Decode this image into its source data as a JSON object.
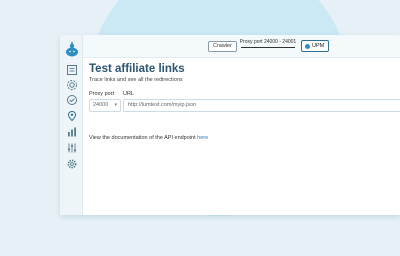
{
  "topbar": {
    "port_button": "Crawler",
    "status_text": "Proxy port 24000 - 24001",
    "upm_label": "UPM"
  },
  "page": {
    "title": "Test affiliate links",
    "subtitle": "Trace links and see all the redirections",
    "proxy_port_label": "Proxy port",
    "url_label": "URL",
    "proxy_port_value": "24000",
    "url_placeholder": "http://lumtest.com/myip.json",
    "doc_text": "View the documentation of the API endpoint",
    "doc_link": "here"
  },
  "sidebar": {
    "items": [
      "overview-icon",
      "proxy-settings-icon",
      "check-icon",
      "link-tracer-icon",
      "stats-icon",
      "filters-icon",
      "settings-icon"
    ]
  },
  "colors": {
    "accent": "#2c8fc0",
    "title": "#2c5570",
    "link": "#2a7bb5"
  }
}
